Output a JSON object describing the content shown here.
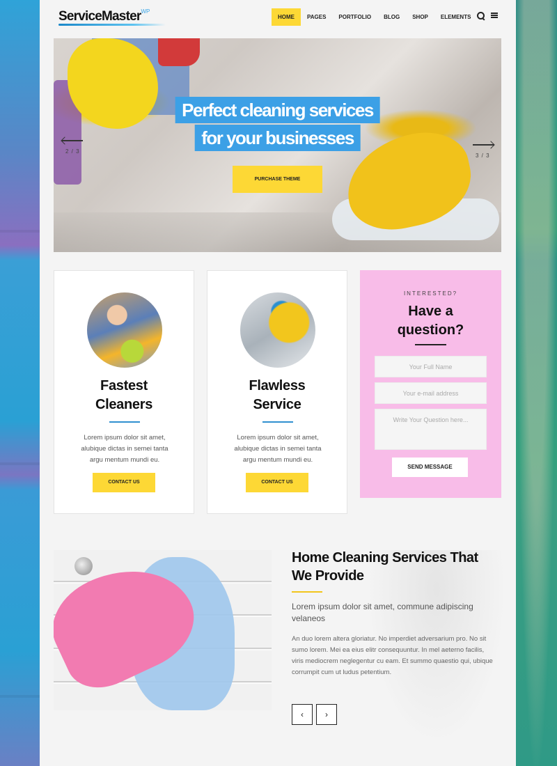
{
  "header": {
    "logo_text": "ServiceMaster",
    "logo_sup": "WP",
    "nav": [
      "HOME",
      "PAGES",
      "PORTFOLIO",
      "BLOG",
      "SHOP",
      "ELEMENTS"
    ],
    "icons": [
      "search-icon",
      "menu-icon"
    ]
  },
  "hero": {
    "line1": "Perfect cleaning services",
    "line2": "for your businesses",
    "button": "PURCHASE THEME",
    "left_counter": "2 / 3",
    "right_counter": "3 / 3"
  },
  "cards": [
    {
      "title": "Fastest\nCleaners",
      "text": "Lorem ipsum dolor sit amet, alubique dictas in semei tanta argu mentum mundi eu.",
      "button": "CONTACT US"
    },
    {
      "title": "Flawless\nService",
      "text": "Lorem ipsum dolor sit amet, alubique dictas in semei tanta argu mentum mundi eu.",
      "button": "CONTACT US"
    }
  ],
  "question": {
    "kicker": "INTERESTED?",
    "title": "Have a\nquestion?",
    "name_placeholder": "Your Full Name",
    "email_placeholder": "Your e-mail address",
    "question_placeholder": "Write Your Question here...",
    "send": "SEND MESSAGE"
  },
  "services": {
    "title": "Home Cleaning Services That We Provide",
    "lead": "Lorem ipsum dolor sit amet, commune adipiscing velaneos",
    "body": "An duo lorem altera gloriatur. No imperdiet adversarium pro. No sit sumo lorem. Mei ea eius elitr consequuntur. In mel aeterno facilis, viris mediocrem neglegentur cu eam. Et summo quaestio qui, ubique corrumpit cum ut ludus petentium.",
    "prev": "‹",
    "next": "›"
  },
  "colors": {
    "accent_yellow": "#fdd835",
    "accent_blue": "#3ca0e6",
    "panel_pink": "#f8bce8"
  }
}
